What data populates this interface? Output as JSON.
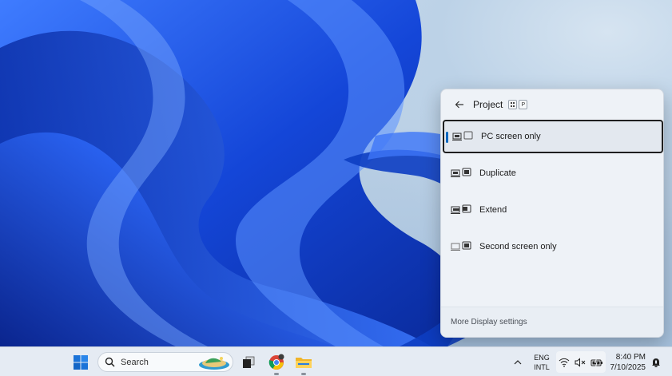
{
  "flyout": {
    "title": "Project",
    "shortcut_key": "P",
    "options": [
      {
        "label": "PC screen only",
        "icon": "pc-screen-only-icon",
        "selected": true
      },
      {
        "label": "Duplicate",
        "icon": "duplicate-icon",
        "selected": false
      },
      {
        "label": "Extend",
        "icon": "extend-icon",
        "selected": false
      },
      {
        "label": "Second screen only",
        "icon": "second-screen-only-icon",
        "selected": false
      }
    ],
    "footer_link": "More Display settings"
  },
  "taskbar": {
    "search_placeholder": "Search",
    "language": {
      "line1": "ENG",
      "line2": "INTL"
    },
    "clock": {
      "time": "8:40 PM",
      "date": "7/10/2025"
    },
    "icons": [
      "windows-start-icon",
      "search-icon",
      "task-view-icon",
      "chrome-icon",
      "file-explorer-icon",
      "chevron-up-icon",
      "wifi-icon",
      "speaker-muted-icon",
      "battery-icon",
      "notification-bell-icon"
    ]
  },
  "colors": {
    "accent": "#0067c0",
    "wallpaper_blue": "#1a4fe0",
    "taskbar_bg": "#e5ebf3",
    "flyout_bg": "#eef2f7"
  }
}
